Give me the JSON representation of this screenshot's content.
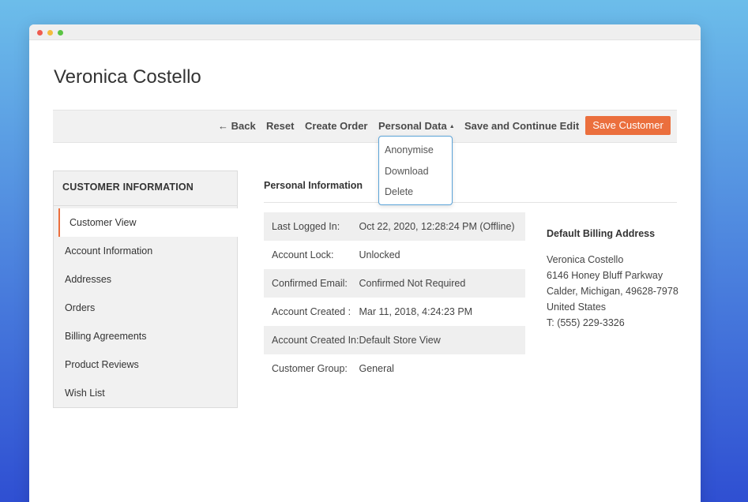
{
  "page": {
    "title": "Veronica Costello"
  },
  "toolbar": {
    "back_icon": "←",
    "back_label": "Back",
    "reset_label": "Reset",
    "create_order_label": "Create Order",
    "personal_data_label": "Personal Data",
    "personal_data_caret": "▲",
    "save_continue_label": "Save and Continue Edit",
    "save_customer_label": "Save Customer",
    "save_customer_color": "#eb6f3d"
  },
  "personal_data_menu": {
    "items": [
      "Anonymise",
      "Download",
      "Delete"
    ]
  },
  "sidebar": {
    "heading": "CUSTOMER INFORMATION",
    "items": [
      "Customer View",
      "Account Information",
      "Addresses",
      "Orders",
      "Billing Agreements",
      "Product Reviews",
      "Wish List"
    ],
    "active_item": "Customer View"
  },
  "personal_info": {
    "heading": "Personal Information",
    "rows": [
      {
        "label": "Last Logged In:",
        "value": "Oct 22, 2020, 12:28:24 PM (Offline)"
      },
      {
        "label": "Account Lock:",
        "value": "Unlocked"
      },
      {
        "label": "Confirmed Email:",
        "value": "Confirmed Not Required"
      },
      {
        "label": "Account Created :",
        "value": "Mar 11, 2018, 4:24:23 PM"
      },
      {
        "label": "Account Created In:",
        "value": "Default Store View"
      },
      {
        "label": "Customer Group:",
        "value": "General"
      }
    ]
  },
  "billing": {
    "heading": "Default Billing Address",
    "lines": [
      "Veronica Costello",
      "6146 Honey Bluff Parkway",
      "Calder, Michigan, 49628-7978",
      "United States",
      "T: (555) 229-3326"
    ]
  }
}
